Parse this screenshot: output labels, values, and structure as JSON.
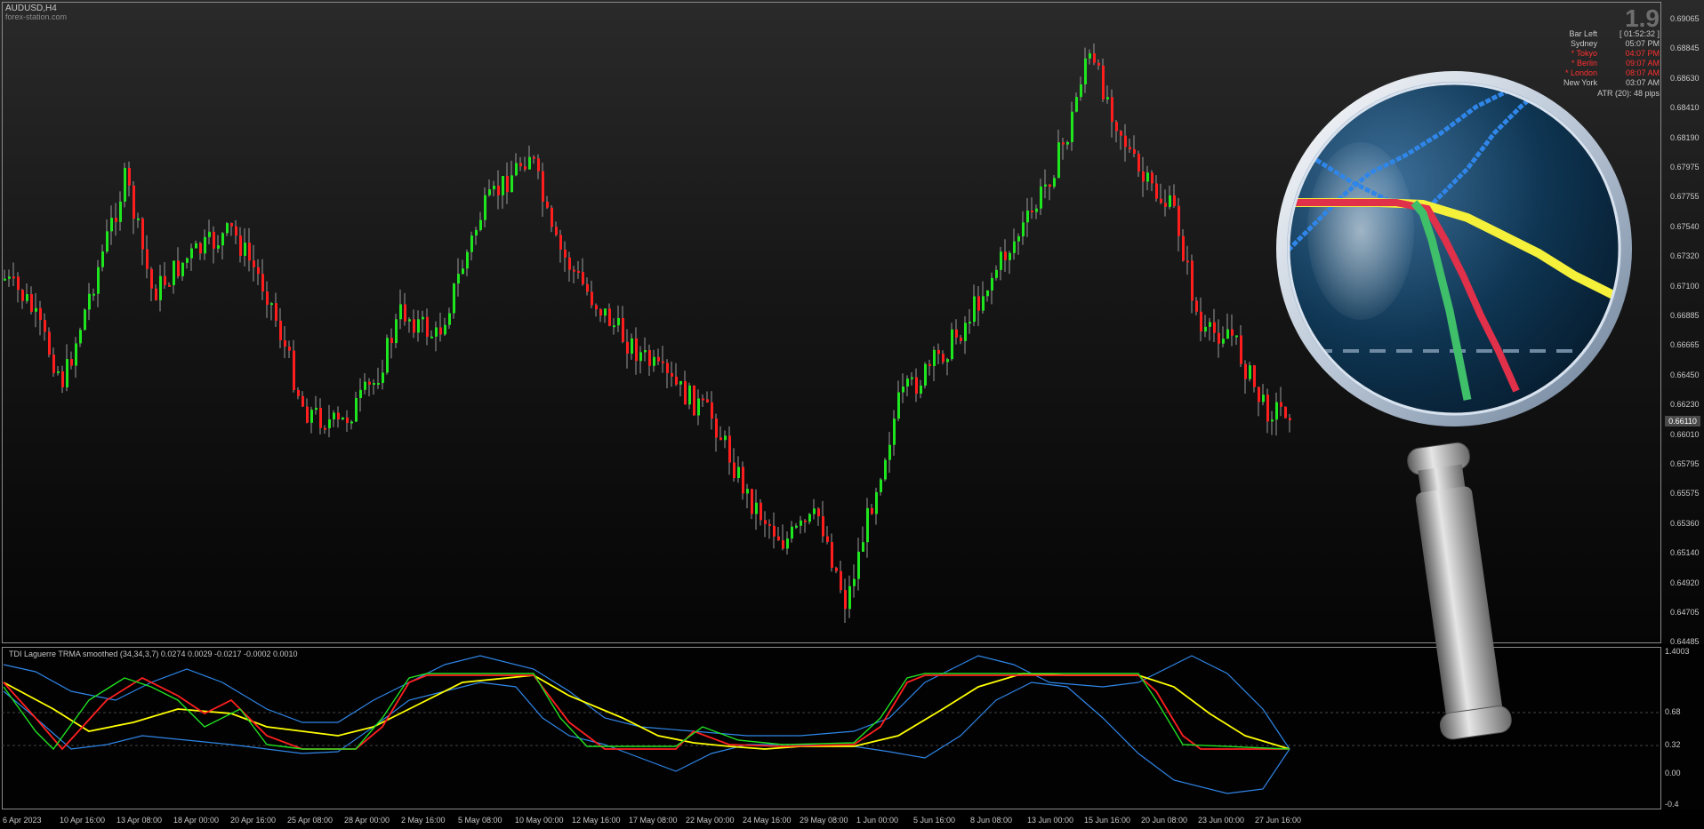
{
  "symbol": "AUDUSD,H4",
  "watermark": "forex-station.com",
  "version": "1.9",
  "current_price": "0.66110",
  "price_axis": [
    "0.69065",
    "0.68845",
    "0.68630",
    "0.68410",
    "0.68190",
    "0.67975",
    "0.67755",
    "0.67540",
    "0.67320",
    "0.67100",
    "0.66885",
    "0.66665",
    "0.66450",
    "0.66230",
    "0.66010",
    "0.65795",
    "0.65575",
    "0.65360",
    "0.65140",
    "0.64920",
    "0.64705",
    "0.64485"
  ],
  "indicator_axis": [
    "1.4003",
    "0.68",
    "0.32",
    "0.00",
    "-0.4"
  ],
  "time_axis": [
    "6 Apr 2023",
    "10 Apr 16:00",
    "13 Apr 08:00",
    "18 Apr 00:00",
    "20 Apr 16:00",
    "25 Apr 08:00",
    "28 Apr 00:00",
    "2 May 16:00",
    "5 May 08:00",
    "10 May 00:00",
    "12 May 16:00",
    "17 May 08:00",
    "22 May 00:00",
    "24 May 16:00",
    "29 May 08:00",
    "1 Jun 00:00",
    "5 Jun 16:00",
    "8 Jun 08:00",
    "13 Jun 00:00",
    "15 Jun 16:00",
    "20 Jun 08:00",
    "23 Jun 00:00",
    "27 Jun 16:00"
  ],
  "indicator_label": "TDI Laguerre TRMA smoothed (34,34,3,7) 0.0274 0.0029 -0.0217 -0.0002 0.0010",
  "info_panel": {
    "bar_left": {
      "label": "Bar Left",
      "value": "[ 01:52:32 ]"
    },
    "sessions": [
      {
        "label": "Sydney",
        "value": "05:07 PM",
        "active": false
      },
      {
        "label": "* Tokyo",
        "value": "04:07 PM",
        "active": true
      },
      {
        "label": "* Berlin",
        "value": "09:07 AM",
        "active": true
      },
      {
        "label": "* London",
        "value": "08:07 AM",
        "active": true
      },
      {
        "label": "New York",
        "value": "03:07 AM",
        "active": false
      }
    ],
    "atr": "ATR (20): 48 pips"
  },
  "colors": {
    "bull_candle": "#1ee61e",
    "bear_candle": "#ff1e1e",
    "wick": "#9a9a9a",
    "line_yellow": "#ffff00",
    "line_red": "#ff2020",
    "line_green": "#20e020",
    "line_blue": "#2f86e8",
    "active_session": "#ff3030",
    "inactive_session": "#c8c8c8"
  },
  "icons": {
    "magnifier": "magnifier-icon"
  }
}
